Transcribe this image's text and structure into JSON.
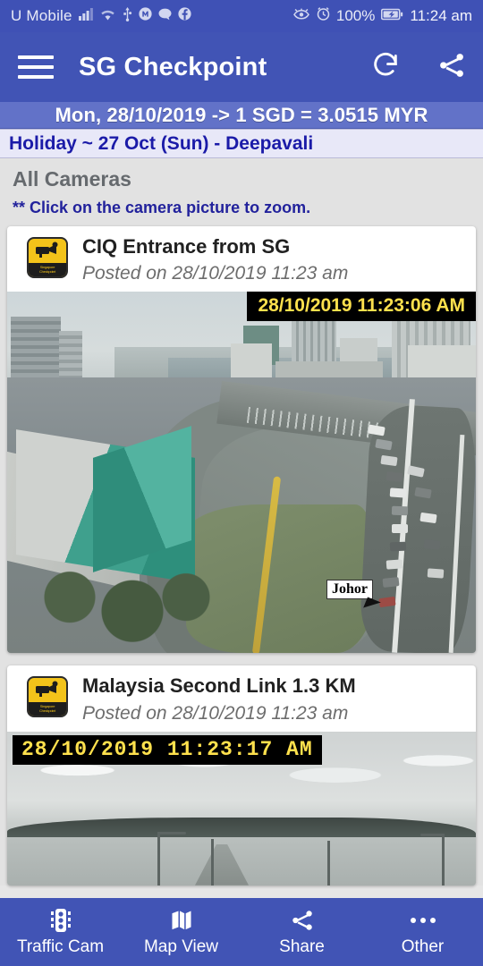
{
  "status_bar": {
    "carrier": "U Mobile",
    "battery_percent": "100%",
    "time": "11:24 am",
    "icons": [
      "signal-bars-icon",
      "wifi-icon",
      "usb-icon",
      "circle-m-icon",
      "messages-icon",
      "facebook-icon",
      "eye-comfort-icon",
      "alarm-clock-icon",
      "battery-charging-icon"
    ]
  },
  "app_bar": {
    "title": "SG Checkpoint",
    "menu_icon": "hamburger-menu-icon",
    "refresh_icon": "refresh-icon",
    "share_icon": "share-icon"
  },
  "rate_banner": {
    "text": "Mon, 28/10/2019 -> 1 SGD = 3.0515 MYR"
  },
  "holiday_banner": {
    "text": "Holiday ~ 27 Oct (Sun) - Deepavali"
  },
  "content": {
    "section_title": "All Cameras",
    "hint": "** Click on the camera picture to zoom."
  },
  "cameras": [
    {
      "name": "CIQ Entrance from SG",
      "posted": "Posted on 28/10/2019 11:23 am",
      "timestamp": "28/10/2019 11:23:06 AM",
      "logo_line1": "Singapore",
      "logo_line2": "Checkpoint",
      "annotation": "Johor"
    },
    {
      "name": "Malaysia Second Link 1.3 KM",
      "posted": "Posted on 28/10/2019 11:23 am",
      "timestamp": "28/10/2019 11:23:17 AM",
      "logo_line1": "Singapore",
      "logo_line2": "Checkpoint"
    }
  ],
  "bottom_nav": [
    {
      "label": "Traffic Cam",
      "icon": "traffic-light-icon"
    },
    {
      "label": "Map View",
      "icon": "map-icon"
    },
    {
      "label": "Share",
      "icon": "share-icon"
    },
    {
      "label": "Other",
      "icon": "ellipsis-icon"
    }
  ],
  "colors": {
    "app_bar": "#4154b5",
    "status_bar": "#3f51b5",
    "rate_banner": "#6272c8",
    "holiday_text": "#1b1ba8",
    "timestamp_text": "#ffe14d",
    "page_bg": "#e2e2e2"
  }
}
